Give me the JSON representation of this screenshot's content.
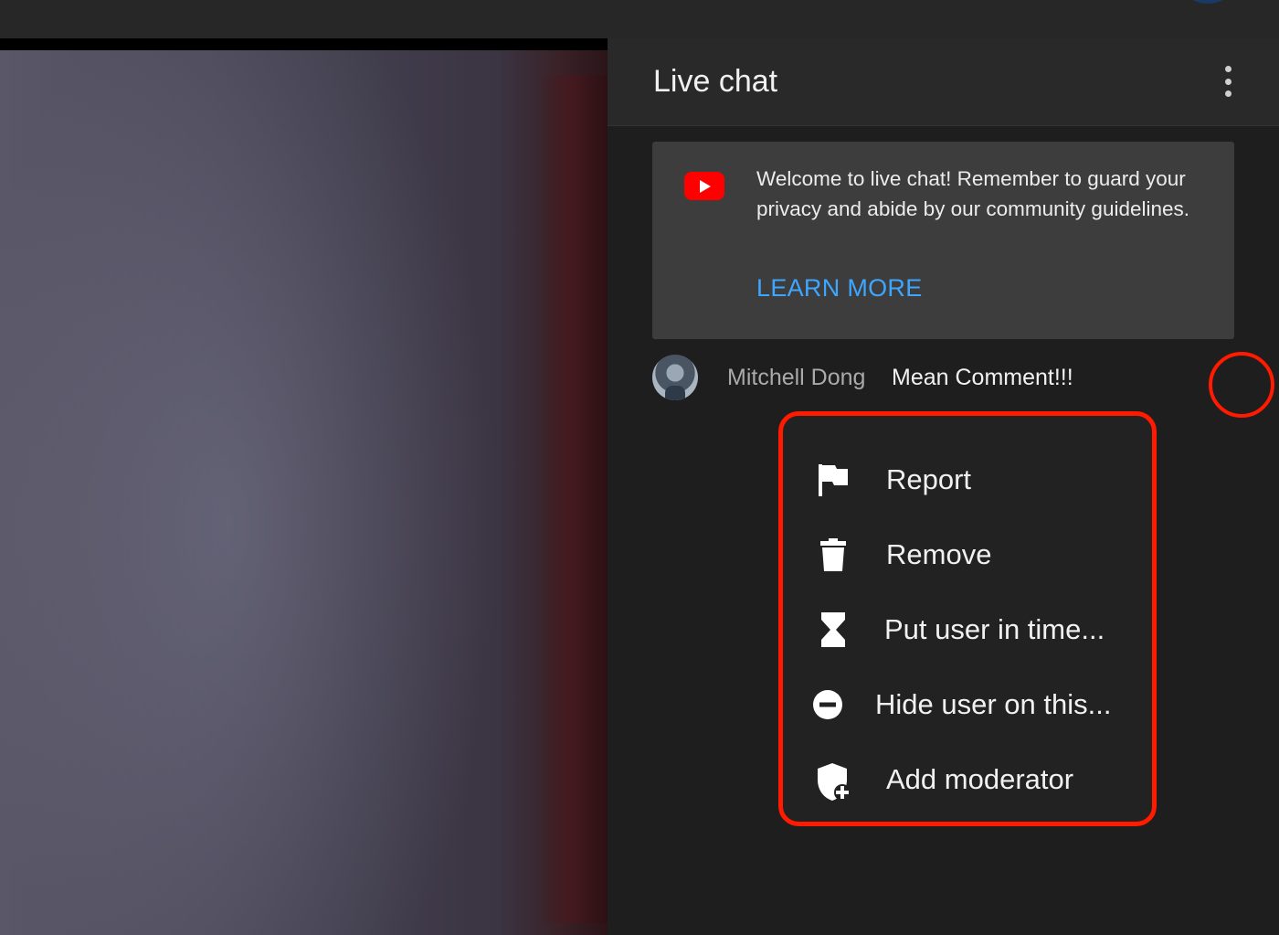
{
  "chat": {
    "title": "Live chat",
    "welcome": {
      "text": "Welcome to live chat! Remember to guard your privacy and abide by our community guidelines.",
      "link_label": "LEARN MORE"
    },
    "message": {
      "author": "Mitchell Dong",
      "text": "Mean Comment!!!"
    }
  },
  "context_menu": {
    "items": [
      {
        "icon": "flag-icon",
        "label": "Report"
      },
      {
        "icon": "trash-icon",
        "label": "Remove"
      },
      {
        "icon": "hourglass-icon",
        "label": "Put user in time..."
      },
      {
        "icon": "minus-circle-icon",
        "label": "Hide user on this..."
      },
      {
        "icon": "shield-plus-icon",
        "label": "Add moderator"
      }
    ]
  },
  "colors": {
    "highlight": "#ff1a00",
    "link": "#3ea6ff",
    "brand": "#ff0000"
  }
}
